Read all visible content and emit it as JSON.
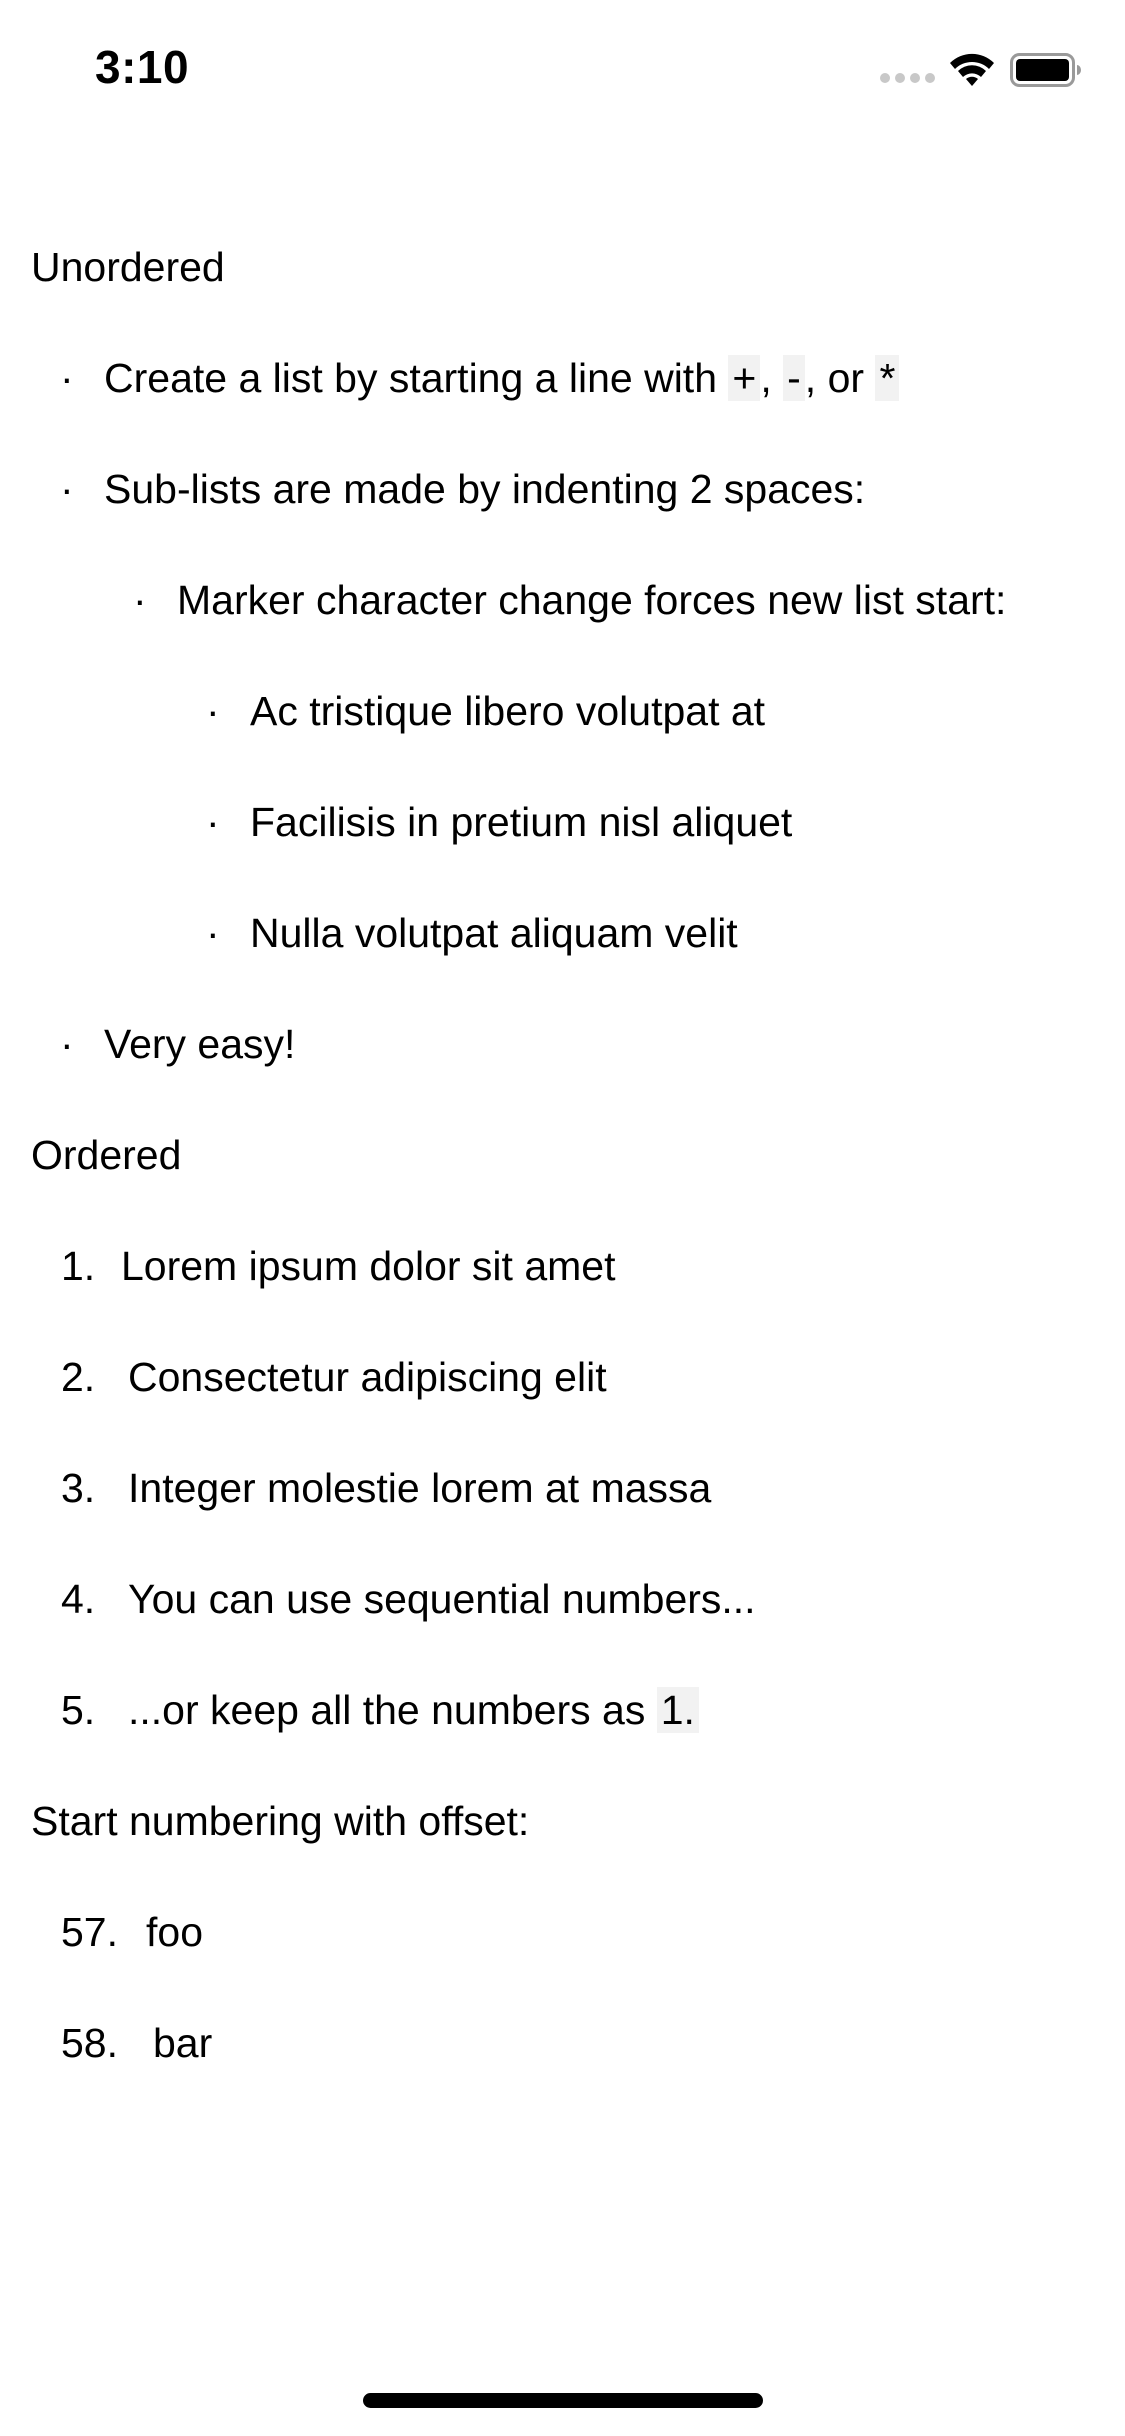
{
  "status_bar": {
    "time": "3:10",
    "signal_icon": "cellular-signal-icon",
    "wifi_icon": "wifi-icon",
    "battery_icon": "battery-icon"
  },
  "unordered": {
    "heading": "Unordered",
    "items": [
      {
        "text_before": "Create a list by starting a line with ",
        "code1": "+",
        "sep1": ", ",
        "code2": "-",
        "sep2": ", or ",
        "code3": "*"
      },
      {
        "text": "Sub-lists are made by indenting 2 spaces:"
      },
      {
        "text": "Marker character change forces new list start:"
      },
      {
        "text": "Ac tristique libero volutpat at"
      },
      {
        "text": "Facilisis in pretium nisl aliquet"
      },
      {
        "text": "Nulla volutpat aliquam velit"
      },
      {
        "text": "Very easy!"
      }
    ],
    "bullet": "·"
  },
  "ordered": {
    "heading": "Ordered",
    "items": [
      {
        "num": "1.",
        "text": "Lorem ipsum dolor sit amet"
      },
      {
        "num": "2.",
        "text": "Consectetur adipiscing elit"
      },
      {
        "num": "3.",
        "text": "Integer molestie lorem at massa"
      },
      {
        "num": "4.",
        "text": "You can use sequential numbers..."
      },
      {
        "num": "5.",
        "text_before": "...or keep all the numbers as ",
        "code": "1."
      }
    ]
  },
  "offset": {
    "heading": "Start numbering with offset:",
    "items": [
      {
        "num": "57.",
        "text": "foo"
      },
      {
        "num": "58.",
        "text": "bar"
      }
    ]
  }
}
